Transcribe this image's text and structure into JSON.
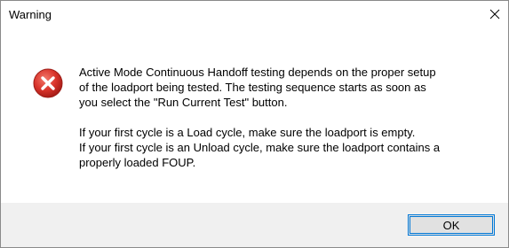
{
  "window": {
    "title": "Warning"
  },
  "icons": {
    "close": "close-icon",
    "status": "error-icon",
    "error_color": "#e03b3b"
  },
  "message": {
    "line1": "Active Mode Continuous Handoff testing depends on the proper setup",
    "line2": "of the loadport being tested.  The testing sequence starts as soon as",
    "line3": "you select the \"Run Current Test\" button.",
    "line4": "If your first cycle is a Load cycle, make sure the loadport is empty.",
    "line5": "If your first cycle is an Unload cycle, make sure the loadport contains a",
    "line6": "properly loaded FOUP."
  },
  "buttons": {
    "ok_label": "OK"
  },
  "colors": {
    "accent": "#0078d7",
    "footer_bg": "#f0f0f0",
    "button_bg": "#e1e1e1"
  }
}
